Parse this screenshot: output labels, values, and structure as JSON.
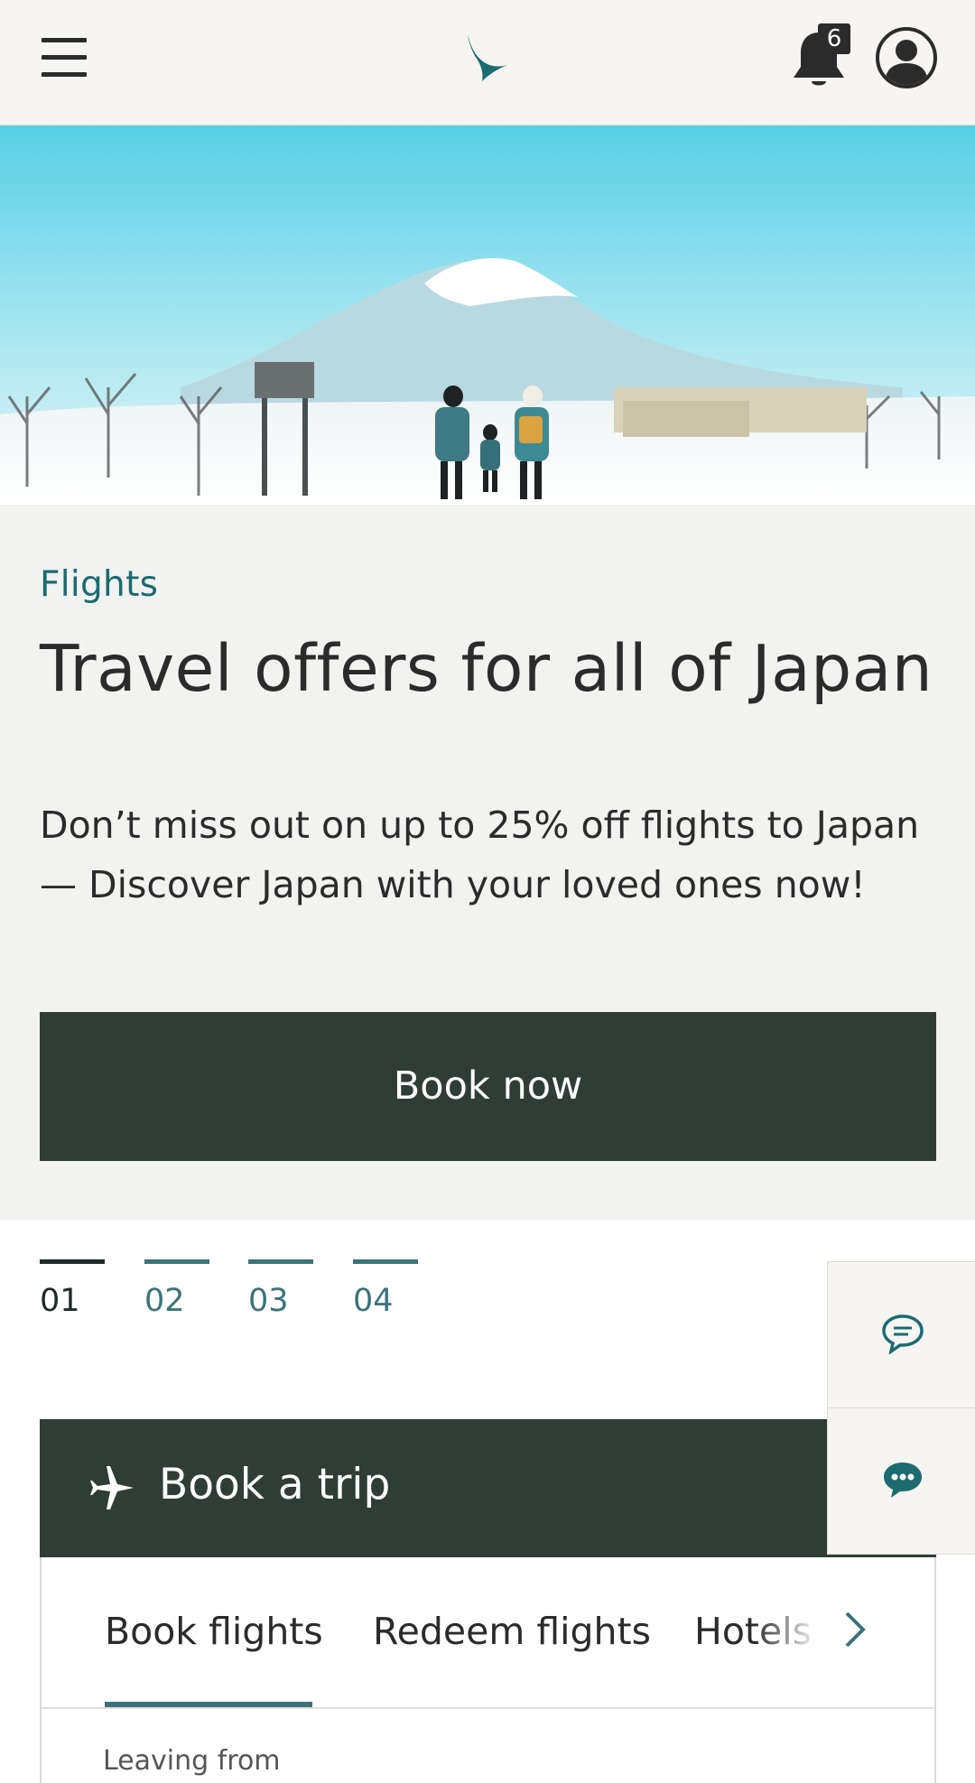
{
  "header": {
    "menu_icon": "hamburger-icon",
    "logo_icon": "brushwing-logo",
    "notification_icon": "bell-icon",
    "notification_count": "6",
    "profile_icon": "user-avatar-icon",
    "brand_color": "#1b6b6f"
  },
  "hero": {
    "image_description": "snowy mountain landscape with family walking"
  },
  "promo": {
    "eyebrow": "Flights",
    "headline": "Travel offers for all of Japan",
    "description": "Don’t miss out on up to 25% off flights to Japan — Discover Japan with your loved ones now!",
    "cta_label": "Book now",
    "cta_color": "#2f3d36"
  },
  "carousel": {
    "slides": [
      "01",
      "02",
      "03",
      "04"
    ],
    "active_index": 0
  },
  "side_actions": {
    "feedback_icon": "chat-outline-icon",
    "chat_icon": "chat-bubble-icon"
  },
  "book_trip": {
    "icon": "airplane-icon",
    "title": "Book a trip",
    "tabs": [
      "Book flights",
      "Redeem flights",
      "Hotels"
    ],
    "active_tab": 0,
    "next_icon": "chevron-right-icon",
    "leaving_from_label": "Leaving from"
  }
}
